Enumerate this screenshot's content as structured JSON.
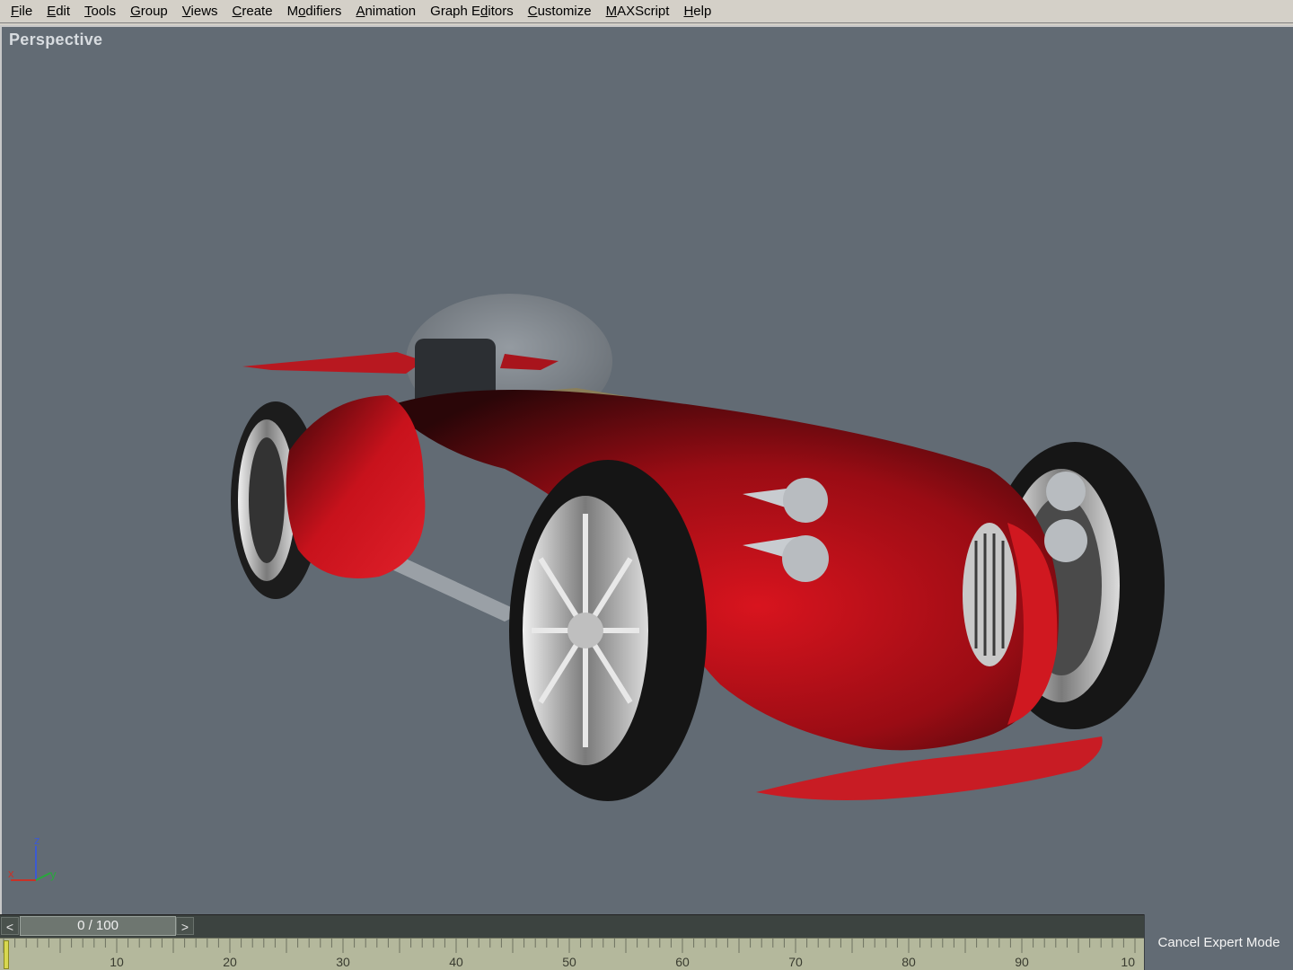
{
  "menu": {
    "items": [
      {
        "pre": "",
        "u": "F",
        "post": "ile"
      },
      {
        "pre": "",
        "u": "E",
        "post": "dit"
      },
      {
        "pre": "",
        "u": "T",
        "post": "ools"
      },
      {
        "pre": "",
        "u": "G",
        "post": "roup"
      },
      {
        "pre": "",
        "u": "V",
        "post": "iews"
      },
      {
        "pre": "",
        "u": "C",
        "post": "reate"
      },
      {
        "pre": "M",
        "u": "o",
        "post": "difiers"
      },
      {
        "pre": "",
        "u": "A",
        "post": "nimation"
      },
      {
        "pre": "Graph E",
        "u": "d",
        "post": "itors"
      },
      {
        "pre": "",
        "u": "C",
        "post": "ustomize"
      },
      {
        "pre": "",
        "u": "M",
        "post": "AXScript"
      },
      {
        "pre": "",
        "u": "H",
        "post": "elp"
      }
    ]
  },
  "viewport": {
    "label": "Perspective",
    "axis": {
      "z": "z",
      "x": "x",
      "y": "y"
    }
  },
  "trackbar": {
    "frame_counter": "0 / 100",
    "prev_icon": "chevron-left-icon",
    "next_icon": "chevron-right-icon",
    "prev_glyph": "<",
    "next_glyph": ">"
  },
  "timeline": {
    "labels": [
      "10",
      "20",
      "30",
      "40",
      "50",
      "60",
      "70",
      "80",
      "90",
      "10"
    ]
  },
  "expert_mode_button": "Cancel Expert Mode",
  "colors": {
    "viewport_bg": "#626b74",
    "car_body": "#b0121a",
    "timeline_bg": "#b4b89c"
  }
}
